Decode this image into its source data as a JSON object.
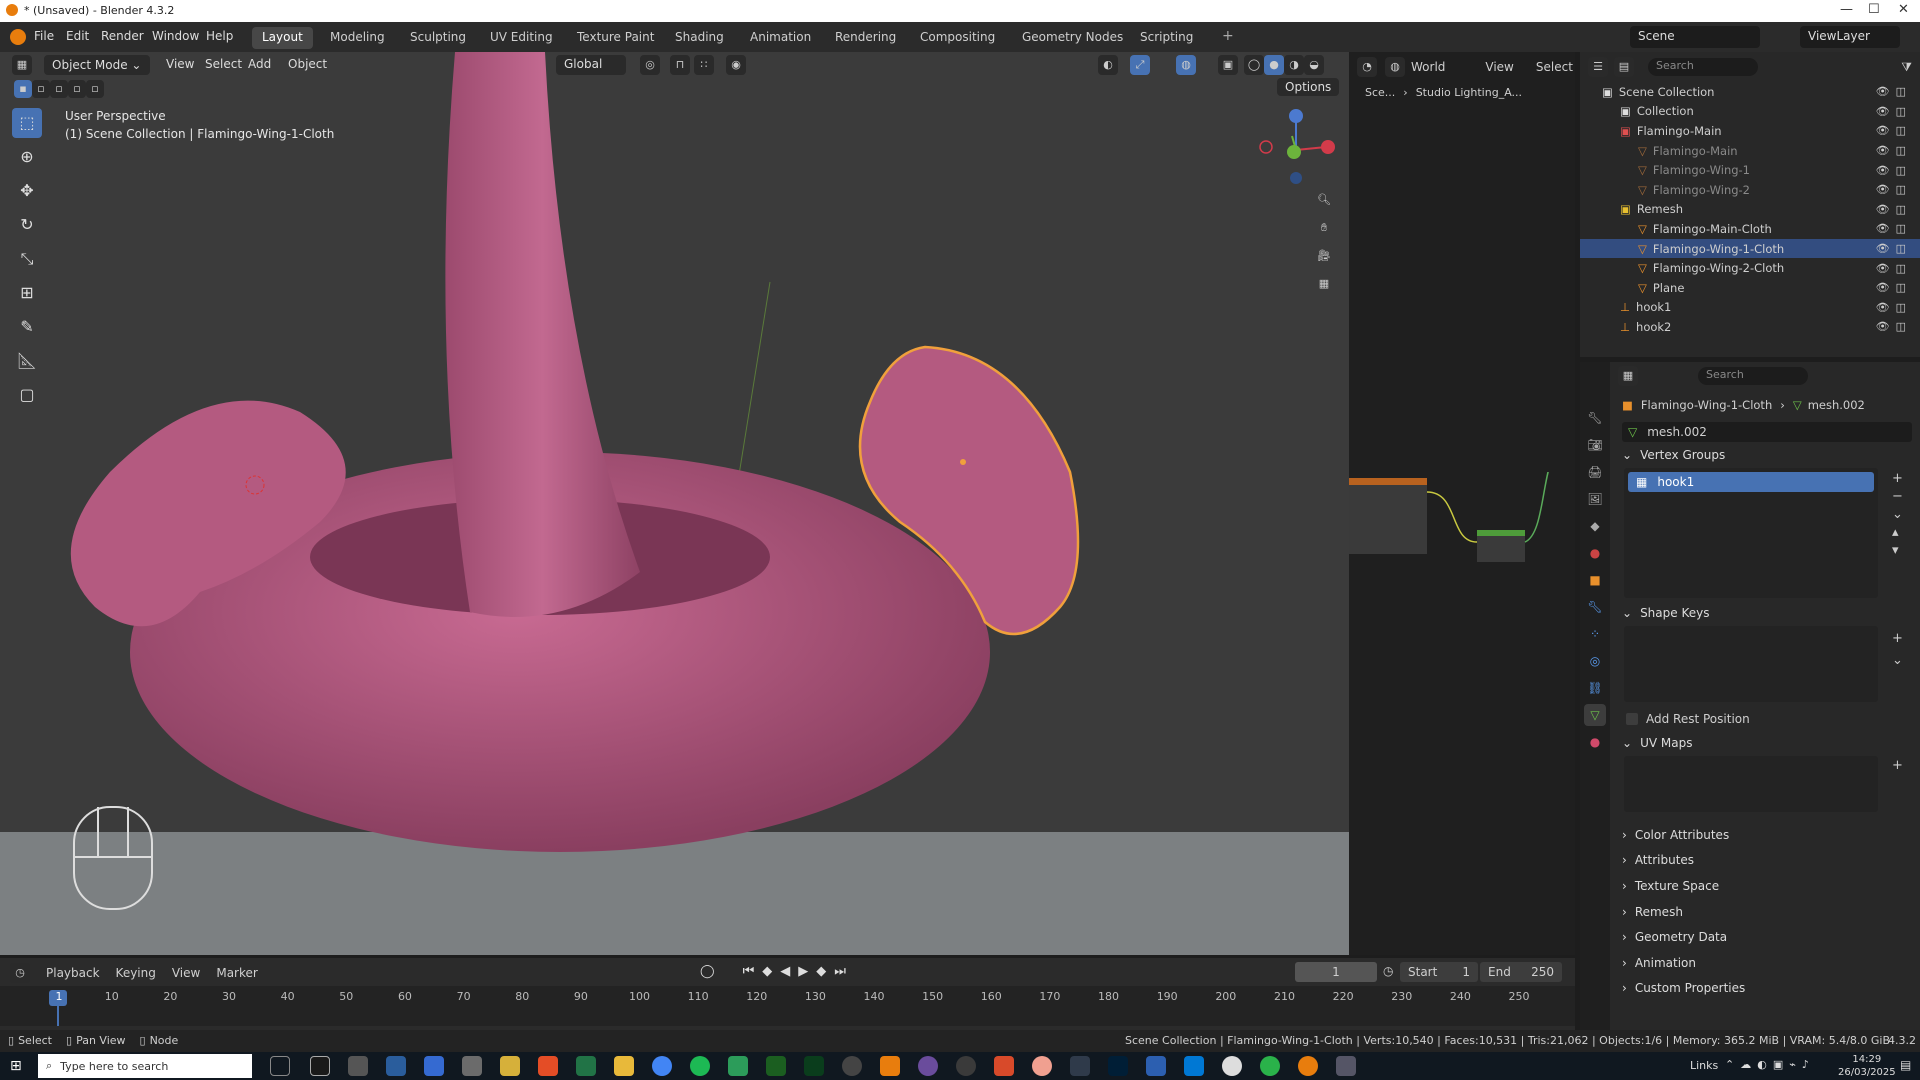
{
  "window": {
    "title": "* (Unsaved) - Blender 4.3.2"
  },
  "menus": [
    "File",
    "Edit",
    "Render",
    "Window",
    "Help"
  ],
  "workspaces": [
    "Layout",
    "Modeling",
    "Sculpting",
    "UV Editing",
    "Texture Paint",
    "Shading",
    "Animation",
    "Rendering",
    "Compositing",
    "Geometry Nodes",
    "Scripting"
  ],
  "active_workspace": "Layout",
  "scene_field": "Scene",
  "viewlayer_field": "ViewLayer",
  "viewport": {
    "mode": "Object Mode",
    "menus": [
      "View",
      "Select",
      "Add",
      "Object"
    ],
    "transform_orientation": "Global",
    "perspective_label": "User Perspective",
    "collection_label": "(1) Scene Collection | Flamingo-Wing-1-Cloth",
    "options_label": "Options"
  },
  "node_editor": {
    "world_label": "World",
    "menus": [
      "View",
      "Select"
    ],
    "breadcrumb_scene": "Sce...",
    "breadcrumb_world": "Studio Lighting_A..."
  },
  "outliner": {
    "search_placeholder": "Search",
    "items": [
      {
        "label": "Scene Collection",
        "level": 0,
        "type": "collection-root"
      },
      {
        "label": "Collection",
        "level": 1,
        "type": "collection"
      },
      {
        "label": "Flamingo-Main",
        "level": 1,
        "type": "collection-red"
      },
      {
        "label": "Flamingo-Main",
        "level": 2,
        "type": "mesh-dim"
      },
      {
        "label": "Flamingo-Wing-1",
        "level": 2,
        "type": "mesh-dim"
      },
      {
        "label": "Flamingo-Wing-2",
        "level": 2,
        "type": "mesh-dim"
      },
      {
        "label": "Remesh",
        "level": 1,
        "type": "collection-yellow"
      },
      {
        "label": "Flamingo-Main-Cloth",
        "level": 2,
        "type": "mesh"
      },
      {
        "label": "Flamingo-Wing-1-Cloth",
        "level": 2,
        "type": "mesh",
        "selected": true
      },
      {
        "label": "Flamingo-Wing-2-Cloth",
        "level": 2,
        "type": "mesh"
      },
      {
        "label": "Plane",
        "level": 2,
        "type": "mesh"
      },
      {
        "label": "hook1",
        "level": 1,
        "type": "empty"
      },
      {
        "label": "hook2",
        "level": 1,
        "type": "empty"
      }
    ]
  },
  "properties": {
    "search_placeholder": "Search",
    "breadcrumb_object": "Flamingo-Wing-1-Cloth",
    "breadcrumb_mesh": "mesh.002",
    "mesh_name": "mesh.002",
    "vertex_groups_label": "Vertex Groups",
    "vertex_group_item": "hook1",
    "shape_keys_label": "Shape Keys",
    "add_rest_position_label": "Add Rest Position",
    "uv_maps_label": "UV Maps",
    "collapsed_panels": [
      "Color Attributes",
      "Attributes",
      "Texture Space",
      "Remesh",
      "Geometry Data",
      "Animation",
      "Custom Properties"
    ]
  },
  "timeline": {
    "menus": [
      "Playback",
      "Keying",
      "View",
      "Marker"
    ],
    "current_frame": "1",
    "start_label": "Start",
    "start_value": "1",
    "end_label": "End",
    "end_value": "250",
    "ticks": [
      "1",
      "10",
      "20",
      "30",
      "40",
      "50",
      "60",
      "70",
      "80",
      "90",
      "100",
      "110",
      "120",
      "130",
      "140",
      "150",
      "160",
      "170",
      "180",
      "190",
      "200",
      "210",
      "220",
      "230",
      "240",
      "250"
    ]
  },
  "statusbar": {
    "left": [
      "Select",
      "Pan View",
      "Node"
    ],
    "stats": "Scene Collection | Flamingo-Wing-1-Cloth | Verts:10,540 | Faces:10,531 | Tris:21,062 | Objects:1/6 | Memory: 365.2 MiB | VRAM: 5.4/8.0 GiB",
    "version": "4.3.2"
  },
  "taskbar": {
    "search_placeholder": "Type here to search",
    "links_label": "Links",
    "time": "14:29",
    "date": "26/03/2025"
  },
  "colors": {
    "accent": "#4772b3",
    "flamingo": "#b85b82",
    "selection_outline": "#f0a03c",
    "viewport_bg": "#3b3b3b"
  }
}
